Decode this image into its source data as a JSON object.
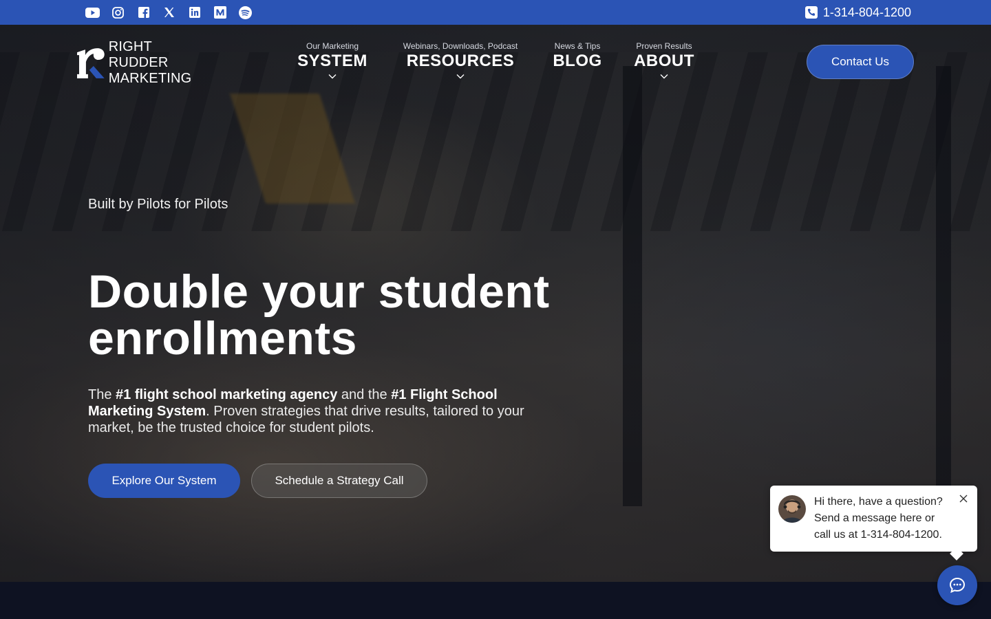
{
  "topbar": {
    "social_icons": [
      "youtube-icon",
      "instagram-icon",
      "facebook-icon",
      "x-icon",
      "linkedin-icon",
      "medium-icon",
      "spotify-icon"
    ],
    "phone": "1-314-804-1200"
  },
  "logo": {
    "line1": "RIGHT RUDDER",
    "line2": "MARKETING"
  },
  "nav": [
    {
      "sub": "Our Marketing",
      "main": "SYSTEM",
      "has_dropdown": true
    },
    {
      "sub": "Webinars, Downloads, Podcast",
      "main": "RESOURCES",
      "has_dropdown": true
    },
    {
      "sub": "News & Tips",
      "main": "BLOG",
      "has_dropdown": false
    },
    {
      "sub": "Proven Results",
      "main": "ABOUT",
      "has_dropdown": true
    }
  ],
  "header": {
    "contact_label": "Contact Us"
  },
  "hero": {
    "tagline": "Built by Pilots for Pilots",
    "headline_line1": "Double your student",
    "headline_line2": "enrollments",
    "sub_1": "The ",
    "sub_bold_1": "#1 flight school marketing agency",
    "sub_2": " and the ",
    "sub_bold_2": "#1 Flight School Marketing System",
    "sub_3": ". Proven strategies that drive results, tailored to your market, be the trusted choice for student pilots.",
    "primary_cta": "Explore Our System",
    "secondary_cta": "Schedule a Strategy Call"
  },
  "chat": {
    "line1": "Hi there, have a question?",
    "line2": "Send a message here or",
    "line3": "call us at 1-314-804-1200."
  },
  "colors": {
    "brand_blue": "#2b54b5",
    "dark_band": "#0e1222"
  }
}
